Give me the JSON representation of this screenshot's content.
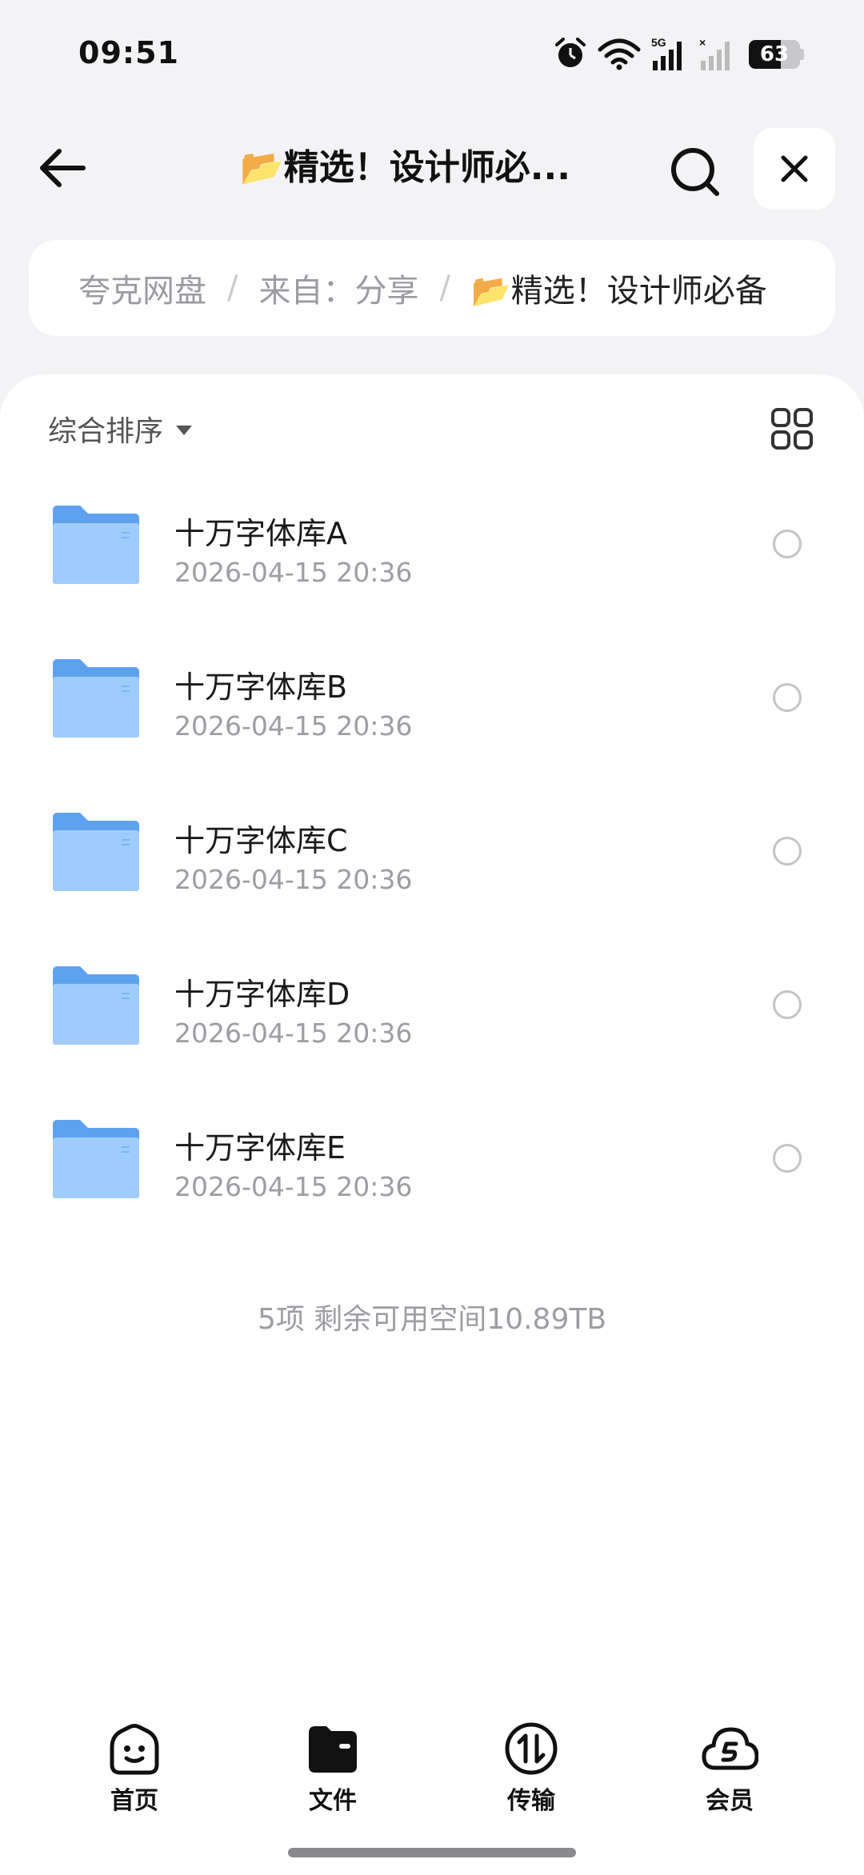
{
  "status_bar": {
    "time": "09:51",
    "battery": "63",
    "battery_level_percent": 63,
    "icons": [
      "alarm-icon",
      "wifi-icon",
      "signal-5g-icon",
      "signal-icon-no-service"
    ]
  },
  "header": {
    "title": "📂精选！设计师必...",
    "icons": [
      "back-arrow-icon",
      "search-icon",
      "close-icon"
    ]
  },
  "breadcrumb": {
    "items": [
      "夸克网盘",
      "来自：分享",
      "📂精选！设计师必备"
    ],
    "separator": "/"
  },
  "toolbar": {
    "sort_label": "综合排序",
    "view_toggle_icon": "grid-view-icon"
  },
  "files": [
    {
      "name": "十万字体库A",
      "date": "2026-04-15 20:36"
    },
    {
      "name": "十万字体库B",
      "date": "2026-04-15 20:36"
    },
    {
      "name": "十万字体库C",
      "date": "2026-04-15 20:36"
    },
    {
      "name": "十万字体库D",
      "date": "2026-04-15 20:36"
    },
    {
      "name": "十万字体库E",
      "date": "2026-04-15 20:36"
    }
  ],
  "summary": "5项 剩余可用空间10.89TB",
  "bottom_nav": {
    "items": [
      {
        "label": "首页",
        "icon": "home-smile-icon"
      },
      {
        "label": "文件",
        "icon": "folder-icon",
        "active": true
      },
      {
        "label": "传输",
        "icon": "transfer-icon"
      },
      {
        "label": "会员",
        "icon": "membership-cloud-icon"
      }
    ]
  },
  "colors": {
    "background": "#f3f3f5",
    "panel": "#ffffff",
    "folder_blue": "#6aa8f5",
    "text_secondary": "#9d9da3"
  }
}
